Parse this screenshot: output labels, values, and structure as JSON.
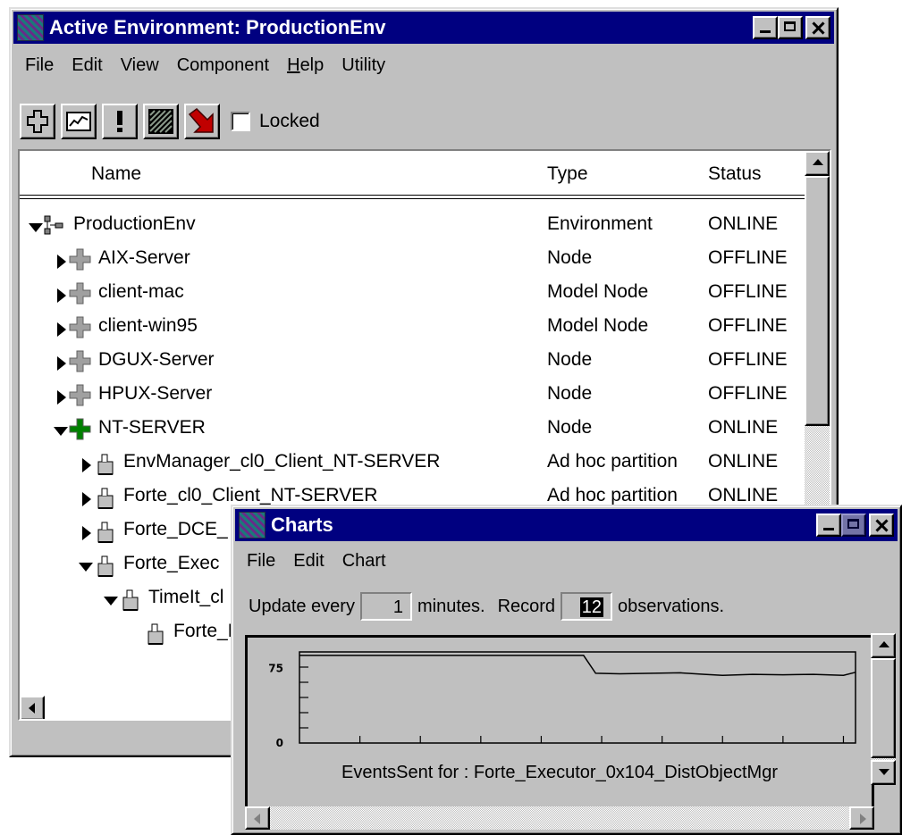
{
  "main": {
    "title": "Active Environment: ProductionEnv",
    "menu": [
      {
        "label": "File"
      },
      {
        "label": "Edit"
      },
      {
        "label": "View"
      },
      {
        "label": "Component"
      },
      {
        "label": "Help",
        "underline": "H",
        "rest": "elp"
      },
      {
        "label": "Utility"
      }
    ],
    "toolbar": {
      "buttons": [
        "node-icon",
        "chart-icon",
        "alert-icon",
        "pattern-icon",
        "arrow-down-icon"
      ],
      "locked_label": "Locked",
      "locked_checked": false
    },
    "columns": {
      "name": "Name",
      "type": "Type",
      "status": "Status"
    },
    "rows": [
      {
        "name": "ProductionEnv",
        "type": "Environment",
        "status": "ONLINE",
        "level": 0,
        "expander": "expanded",
        "icon": "environment"
      },
      {
        "name": "AIX-Server",
        "type": "Node",
        "status": "OFFLINE",
        "level": 1,
        "expander": "collapsed",
        "icon": "node-gray"
      },
      {
        "name": "client-mac",
        "type": "Model Node",
        "status": "OFFLINE",
        "level": 1,
        "expander": "collapsed",
        "icon": "node-gray"
      },
      {
        "name": "client-win95",
        "type": "Model Node",
        "status": "OFFLINE",
        "level": 1,
        "expander": "collapsed",
        "icon": "node-gray"
      },
      {
        "name": "DGUX-Server",
        "type": "Node",
        "status": "OFFLINE",
        "level": 1,
        "expander": "collapsed",
        "icon": "node-gray"
      },
      {
        "name": "HPUX-Server",
        "type": "Node",
        "status": "OFFLINE",
        "level": 1,
        "expander": "collapsed",
        "icon": "node-gray"
      },
      {
        "name": "NT-SERVER",
        "type": "Node",
        "status": "ONLINE",
        "level": 1,
        "expander": "expanded",
        "icon": "node-green"
      },
      {
        "name": "EnvManager_cl0_Client_NT-SERVER",
        "type": "Ad hoc partition",
        "status": "ONLINE",
        "level": 2,
        "expander": "collapsed",
        "icon": "partition"
      },
      {
        "name": "Forte_cl0_Client_NT-SERVER",
        "type": "Ad hoc partition",
        "status": "ONLINE",
        "level": 2,
        "expander": "collapsed",
        "icon": "partition"
      },
      {
        "name": "Forte_DCE_",
        "type": "",
        "status": "",
        "level": 2,
        "expander": "collapsed",
        "icon": "partition"
      },
      {
        "name": "Forte_Exec",
        "type": "",
        "status": "",
        "level": 2,
        "expander": "expanded",
        "icon": "partition"
      },
      {
        "name": "TimeIt_cl",
        "type": "",
        "status": "",
        "level": 3,
        "expander": "expanded",
        "icon": "partition"
      },
      {
        "name": "Forte_E",
        "type": "",
        "status": "",
        "level": 4,
        "expander": "none",
        "icon": "partition"
      }
    ]
  },
  "charts": {
    "title": "Charts",
    "menu": [
      {
        "label": "File"
      },
      {
        "label": "Edit"
      },
      {
        "label": "Chart"
      }
    ],
    "update_prefix": "Update every",
    "update_value": "1",
    "update_suffix": "minutes.",
    "record_prefix": "Record",
    "record_value": "12",
    "record_suffix": "observations.",
    "chart_caption": "EventsSent for : Forte_Executor_0x104_DistObjectMgr"
  },
  "chart_data": {
    "type": "line",
    "title": "",
    "xlabel": "EventsSent for : Forte_Executor_0x104_DistObjectMgr",
    "ylabel": "",
    "yticks": [
      "75",
      "0"
    ],
    "ylim": [
      0,
      75
    ],
    "x_divisions": 9,
    "series": [
      {
        "x": [
          0,
          4.7,
          4.9,
          5.3,
          6.3,
          6.7,
          7.0,
          7.5,
          8.0,
          8.5,
          9.0,
          9.2
        ],
        "values": [
          88,
          88,
          70,
          69.5,
          70.5,
          69,
          68,
          69,
          68.5,
          69,
          68,
          71
        ]
      }
    ],
    "colors": {
      "line": "#000000",
      "plot_bg": "#c0c0c0"
    }
  }
}
